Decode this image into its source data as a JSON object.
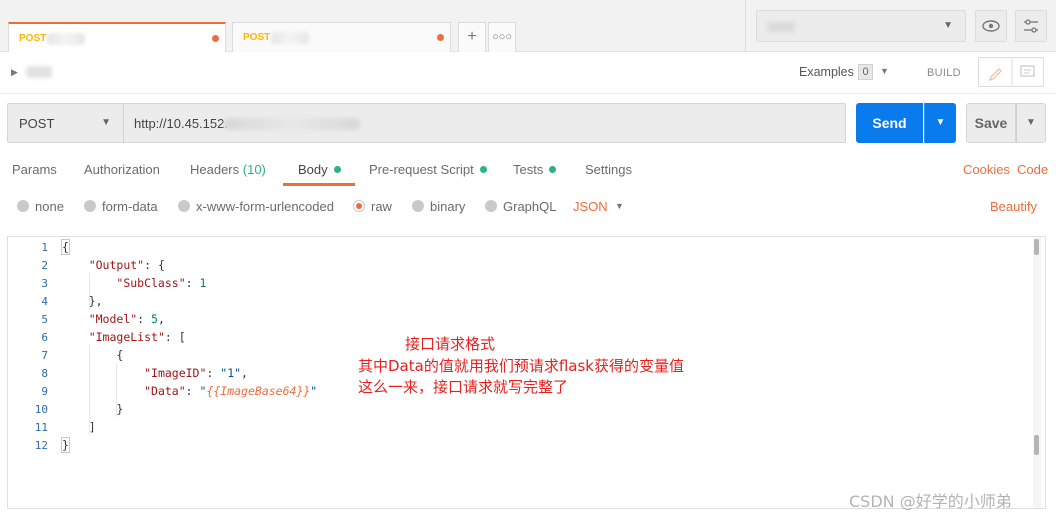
{
  "tabs": [
    {
      "method": "POST",
      "active": true
    },
    {
      "method": "POST",
      "active": false
    }
  ],
  "name_row": {
    "examples_label": "Examples",
    "examples_count": "0",
    "build_label": "BUILD"
  },
  "request": {
    "method": "POST",
    "url": "http://10.45.152.",
    "send_label": "Send",
    "save_label": "Save"
  },
  "request_tabs": {
    "params": "Params",
    "authorization": "Authorization",
    "headers": "Headers",
    "headers_count": "(10)",
    "body": "Body",
    "prerequest": "Pre-request Script",
    "tests": "Tests",
    "settings": "Settings",
    "cookies": "Cookies",
    "code": "Code"
  },
  "body_types": {
    "none": "none",
    "form_data": "form-data",
    "urlencoded": "x-www-form-urlencoded",
    "raw": "raw",
    "binary": "binary",
    "graphql": "GraphQL",
    "format": "JSON",
    "beautify": "Beautify"
  },
  "editor": {
    "line_numbers": [
      "1",
      "2",
      "3",
      "4",
      "5",
      "6",
      "7",
      "8",
      "9",
      "10",
      "11",
      "12"
    ],
    "keys": {
      "output": "\"Output\"",
      "subclass": "\"SubClass\"",
      "model": "\"Model\"",
      "imagelist": "\"ImageList\"",
      "imageid": "\"ImageID\"",
      "data": "\"Data\""
    },
    "values": {
      "subclass": "1",
      "model": "5",
      "imageid": "\"1\"",
      "data_template": "{{ImageBase64}}"
    }
  },
  "annotation": {
    "line1": "接口请求格式",
    "line2": "其中Data的值就用我们预请求flask获得的变量值",
    "line3": "这么一来，接口请求就写完整了"
  },
  "watermark": "CSDN @好学的小师弟",
  "colors": {
    "accent": "#f26b3a",
    "send_blue": "#097bed",
    "active_green": "#26b47f",
    "annotation_red": "#e8201e"
  }
}
